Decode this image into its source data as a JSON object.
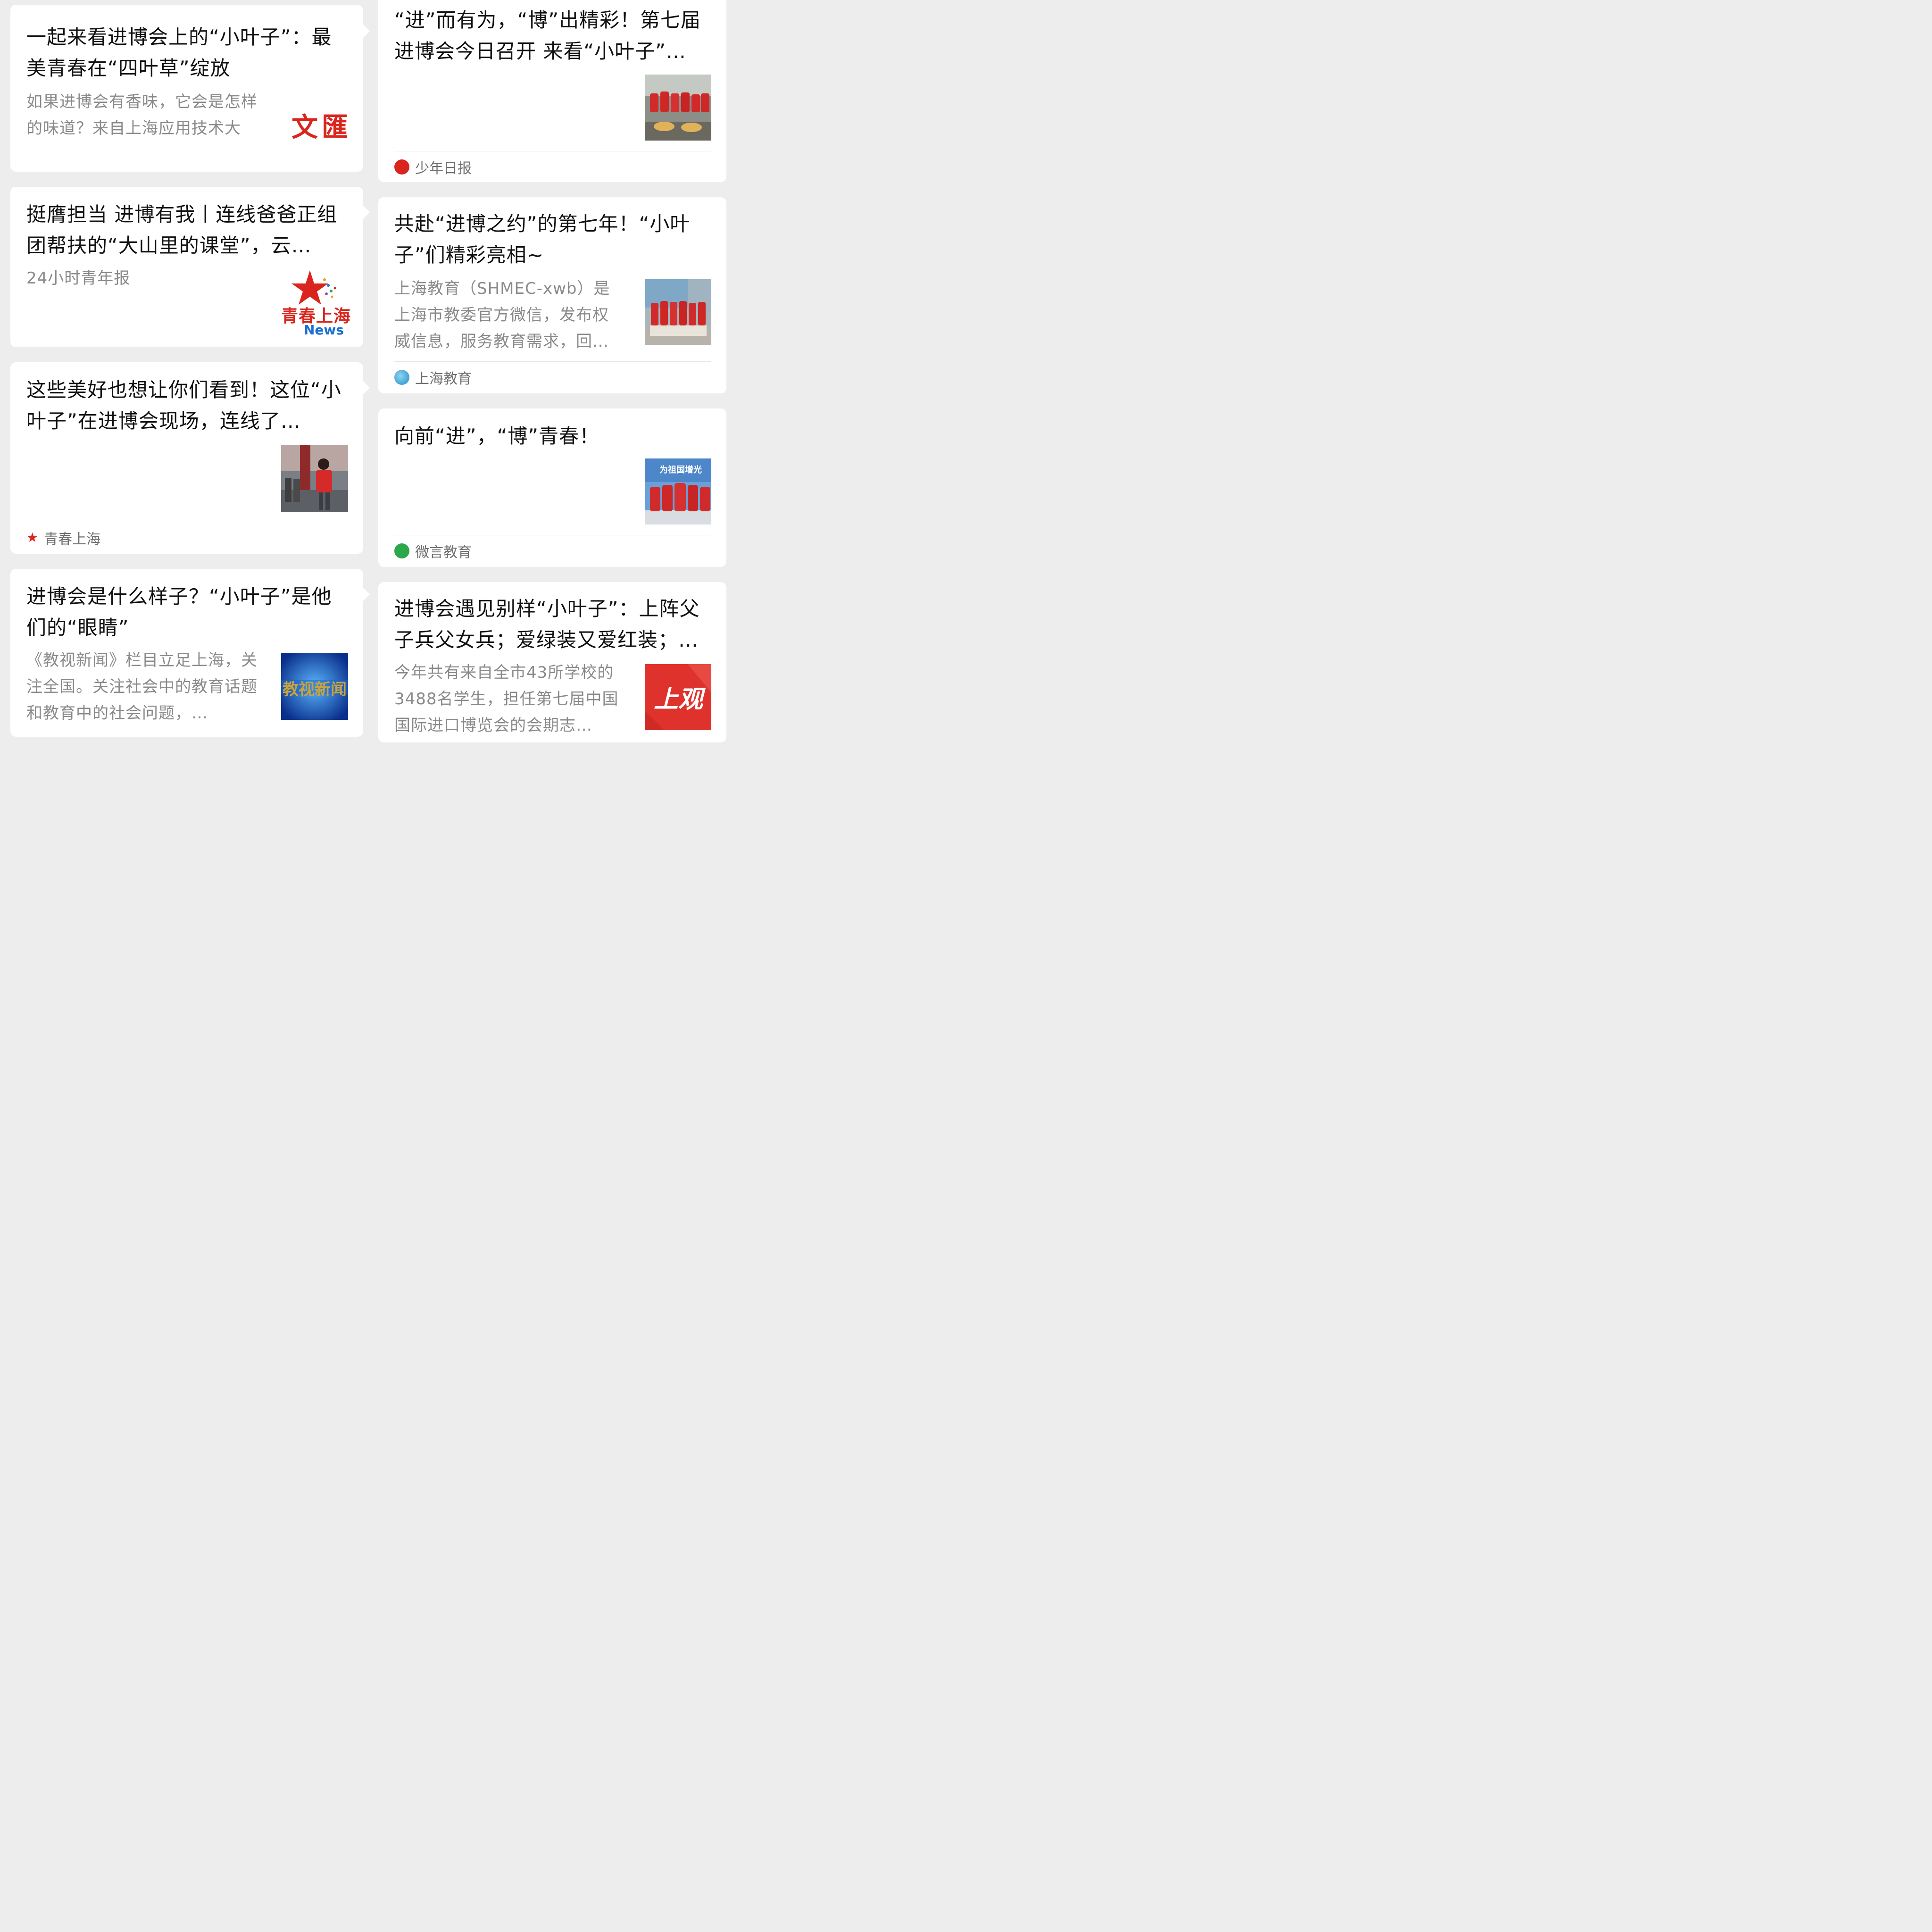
{
  "cards": {
    "c1": {
      "title": "一起来看进博会上的“小叶子”：最美青春在“四叶草”绽放",
      "digest": "如果进博会有香味，它会是怎样的味道？来自上海应用技术大",
      "logo_text": "文匯"
    },
    "c2": {
      "title": "挺膺担当 进博有我丨连线爸爸正组团帮扶的“大山里的课堂”，云…",
      "digest": "24小时青年报",
      "logo_line1": "青春上海",
      "logo_line2": "News"
    },
    "c3": {
      "title": "这些美好也想让你们看到！这位“小叶子”在进博会现场，连线了…",
      "source": "青春上海"
    },
    "c4": {
      "title": "进博会是什么样子？“小叶子”是他们的“眼睛”",
      "digest": "《教视新闻》栏目立足上海，关注全国。关注社会中的教育话题和教育中的社会问题，…",
      "thumb_text": "教视新闻"
    },
    "c5": {
      "title": "“进”而有为，“博”出精彩！第七届进博会今日召开 来看“小叶子”…",
      "source": "少年日报"
    },
    "c6": {
      "title": "共赴“进博之约”的第七年！“小叶子”们精彩亮相~",
      "digest": "上海教育（SHMEC-xwb）是上海市教委官方微信，发布权威信息，服务教育需求，回…",
      "source": "上海教育"
    },
    "c7": {
      "title": "向前“进”，“博”青春！",
      "thumb_text": "为祖国增光",
      "source": "微言教育"
    },
    "c8": {
      "title": "进博会遇见别样“小叶子”：上阵父子兵父女兵；爱绿装又爱红装；…",
      "digest": "今年共有来自全市43所学校的3488名学生，担任第七届中国国际进口博览会的会期志…",
      "thumb_text": "上观"
    }
  },
  "colors": {
    "background": "#ededed",
    "card": "#ffffff",
    "title": "#111111",
    "digest": "#8a8a8a",
    "source": "#6f6f6f",
    "brand_red": "#d9251d",
    "brand_blue": "#1d6fd1",
    "green": "#2aa84a"
  }
}
